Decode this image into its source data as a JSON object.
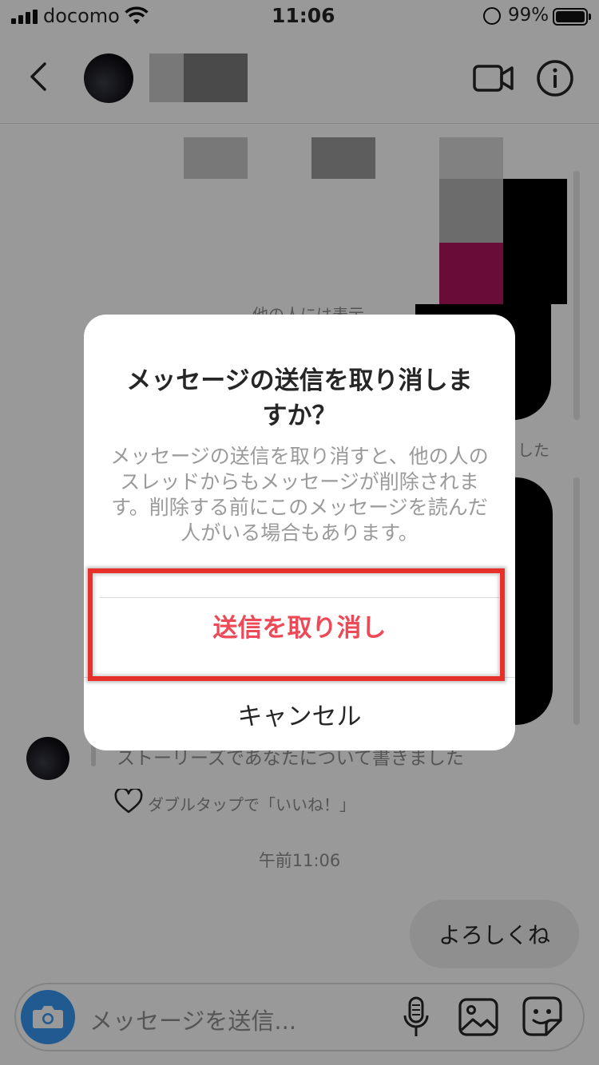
{
  "status_bar": {
    "carrier": "docomo",
    "time": "11:06",
    "battery": "99%"
  },
  "header": {
    "icons": [
      "back-icon",
      "video-call-icon",
      "info-icon"
    ]
  },
  "chat": {
    "hidden_note": "他の人には表示",
    "unsent_suffix": "した",
    "story_mention": "ストーリーズであなたについて書きました",
    "like_hint": "ダブルタップで「いいね！」",
    "timestamp": "午前11:06",
    "my_message": "よろしくね"
  },
  "dialog": {
    "title": "メッセージの送信を取り消しますか？",
    "body": "メッセージの送信を取り消すと、他の人のスレッドからもメッセージが削除されます。削除する前にこのメッセージを読んだ人がいる場合もあります。",
    "unsend_label": "送信を取り消し",
    "cancel_label": "キャンセル"
  },
  "input": {
    "placeholder": "メッセージを送信..."
  },
  "colors": {
    "destructive": "#ed4956",
    "highlight": "#e8302a",
    "camera_button": "#3897f0"
  }
}
